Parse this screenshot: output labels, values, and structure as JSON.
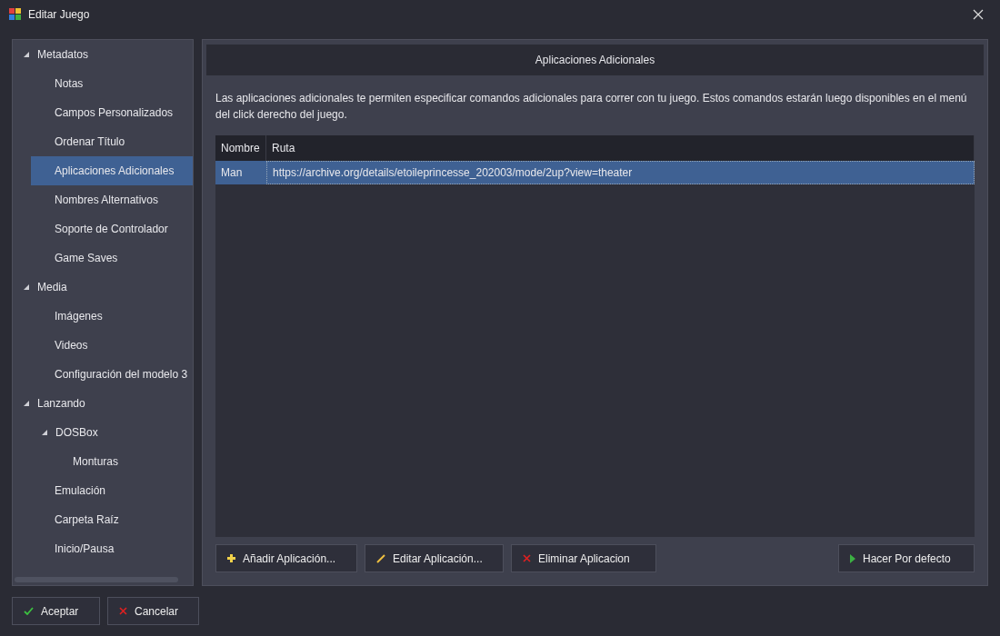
{
  "window": {
    "title": "Editar Juego"
  },
  "sidebar": {
    "items": [
      {
        "label": "Metadatos",
        "expanded": true,
        "selected": false,
        "children": [
          {
            "label": "Notas",
            "selected": false
          },
          {
            "label": "Campos Personalizados",
            "selected": false
          },
          {
            "label": "Ordenar Título",
            "selected": false
          },
          {
            "label": "Aplicaciones Adicionales",
            "selected": true
          },
          {
            "label": "Nombres Alternativos",
            "selected": false
          },
          {
            "label": "Soporte de Controlador",
            "selected": false
          },
          {
            "label": "Game Saves",
            "selected": false
          }
        ]
      },
      {
        "label": "Media",
        "expanded": true,
        "selected": false,
        "children": [
          {
            "label": "Imágenes",
            "selected": false
          },
          {
            "label": "Videos",
            "selected": false
          },
          {
            "label": "Configuración del modelo 3",
            "selected": false
          }
        ]
      },
      {
        "label": "Lanzando",
        "expanded": true,
        "selected": false,
        "children": [
          {
            "label": "DOSBox",
            "expanded": true,
            "selected": false,
            "children": [
              {
                "label": "Monturas",
                "selected": false
              }
            ]
          },
          {
            "label": "Emulación",
            "selected": false
          },
          {
            "label": "Carpeta Raíz",
            "selected": false
          },
          {
            "label": "Inicio/Pausa",
            "selected": false
          }
        ]
      }
    ]
  },
  "panel": {
    "title": "Aplicaciones Adicionales",
    "description": "Las aplicaciones adicionales te permiten especificar comandos adicionales para correr con tu juego. Estos comandos estarán luego disponibles en el menú del click derecho del juego.",
    "table": {
      "columns": [
        "Nombre",
        "Ruta"
      ],
      "rows": [
        {
          "cells": [
            "Man",
            "https://archive.org/details/etoileprincesse_202003/mode/2up?view=theater"
          ],
          "selected": true
        }
      ]
    },
    "buttons": [
      {
        "label": "Añadir Aplicación...",
        "kind": "add"
      },
      {
        "label": "Editar Aplicación...",
        "kind": "edit"
      },
      {
        "label": "Eliminar Aplicacion",
        "kind": "delete"
      },
      {
        "label": "Hacer Por defecto",
        "kind": "default"
      }
    ]
  },
  "footer_buttons": [
    {
      "label": "Aceptar",
      "kind": "ok"
    },
    {
      "label": "Cancelar",
      "kind": "cancel"
    }
  ]
}
